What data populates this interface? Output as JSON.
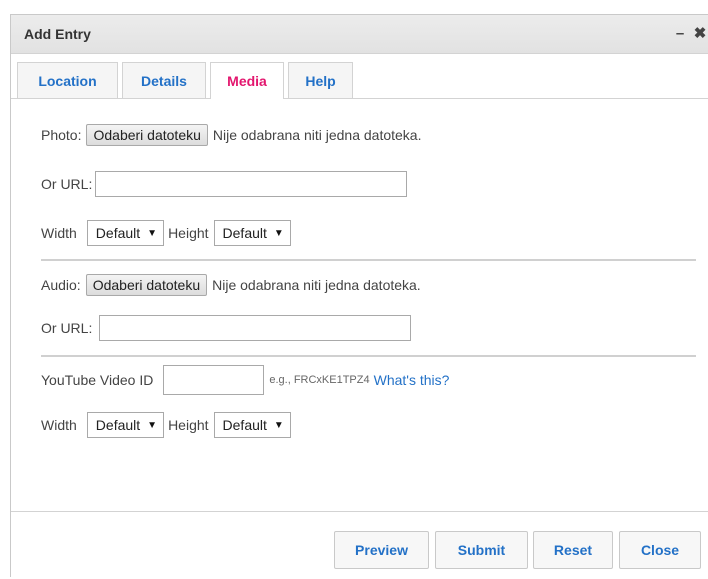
{
  "dialog": {
    "title": "Add Entry",
    "minimize_glyph": "–",
    "close_glyph": "✖"
  },
  "tabs": [
    {
      "label": "Location",
      "active": false
    },
    {
      "label": "Details",
      "active": false
    },
    {
      "label": "Media",
      "active": true
    },
    {
      "label": "Help",
      "active": false
    }
  ],
  "photo": {
    "label": "Photo:",
    "file_button": "Odaberi datoteku",
    "file_status": "Nije odabrana niti jedna datoteka.",
    "url_label": "Or URL:",
    "url_value": "",
    "width_label": "Width",
    "width_value": "Default",
    "height_label": "Height",
    "height_value": "Default"
  },
  "audio": {
    "label": "Audio:",
    "file_button": "Odaberi datoteku",
    "file_status": "Nije odabrana niti jedna datoteka.",
    "url_label": "Or URL:",
    "url_value": ""
  },
  "youtube": {
    "label": "YouTube Video ID",
    "value": "",
    "hint": "e.g., FRCxKE1TPZ4",
    "help_link": "What's this?",
    "width_label": "Width",
    "width_value": "Default",
    "height_label": "Height",
    "height_value": "Default"
  },
  "footer": {
    "preview": "Preview",
    "submit": "Submit",
    "reset": "Reset",
    "close": "Close"
  },
  "colors": {
    "link_blue": "#2371c7",
    "active_tab": "#e3166e"
  }
}
